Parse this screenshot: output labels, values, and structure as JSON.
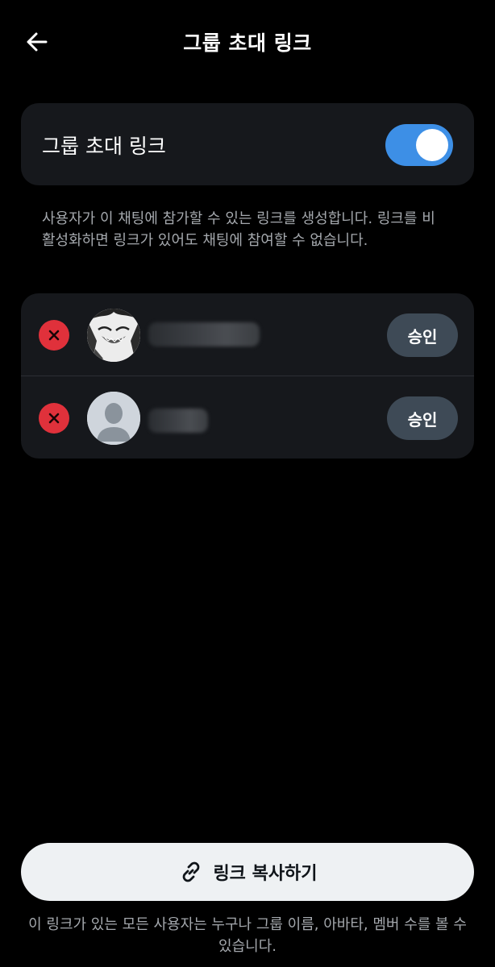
{
  "header": {
    "title": "그룹 초대 링크",
    "back_icon": "arrow-left-icon"
  },
  "invite_toggle": {
    "label": "그룹 초대 링크",
    "enabled": true,
    "accent_color": "#3d8fe6"
  },
  "description": "사용자가 이 채팅에 참가할 수 있는 링크를 생성합니다. 링크를 비활성화하면 링크가 있어도 채팅에 참여할 수 없습니다.",
  "requests": {
    "items": [
      {
        "avatar": "photo",
        "approve_label": "승인",
        "reject_icon": "close-icon"
      },
      {
        "avatar": "default-person",
        "approve_label": "승인",
        "reject_icon": "close-icon"
      }
    ],
    "reject_color": "#e0313b"
  },
  "copy_button": {
    "label": "링크 복사하기",
    "icon": "link-icon"
  },
  "footer_note": "이 링크가 있는 모든 사용자는 누구나 그룹 이름, 아바타, 멤버 수를 볼 수 있습니다."
}
